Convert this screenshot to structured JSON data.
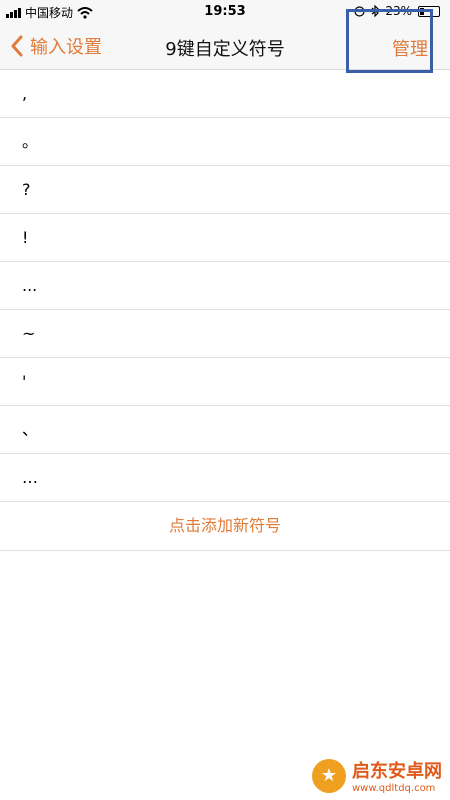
{
  "status_bar": {
    "carrier": "中国移动",
    "time": "19:53",
    "battery_text": "23%",
    "battery_level": 0.23
  },
  "nav": {
    "back_label": "输入设置",
    "title": "9键自定义符号",
    "manage_label": "管理"
  },
  "symbols": [
    ",",
    "。",
    "?",
    "!",
    "...",
    "~",
    "'",
    "、",
    "…"
  ],
  "add_label": "点击添加新符号",
  "watermark": {
    "name": "启东安卓网",
    "url": "www.qdltdq.com"
  },
  "colors": {
    "accent": "#e07b3a",
    "highlight": "#3a5ea8"
  }
}
